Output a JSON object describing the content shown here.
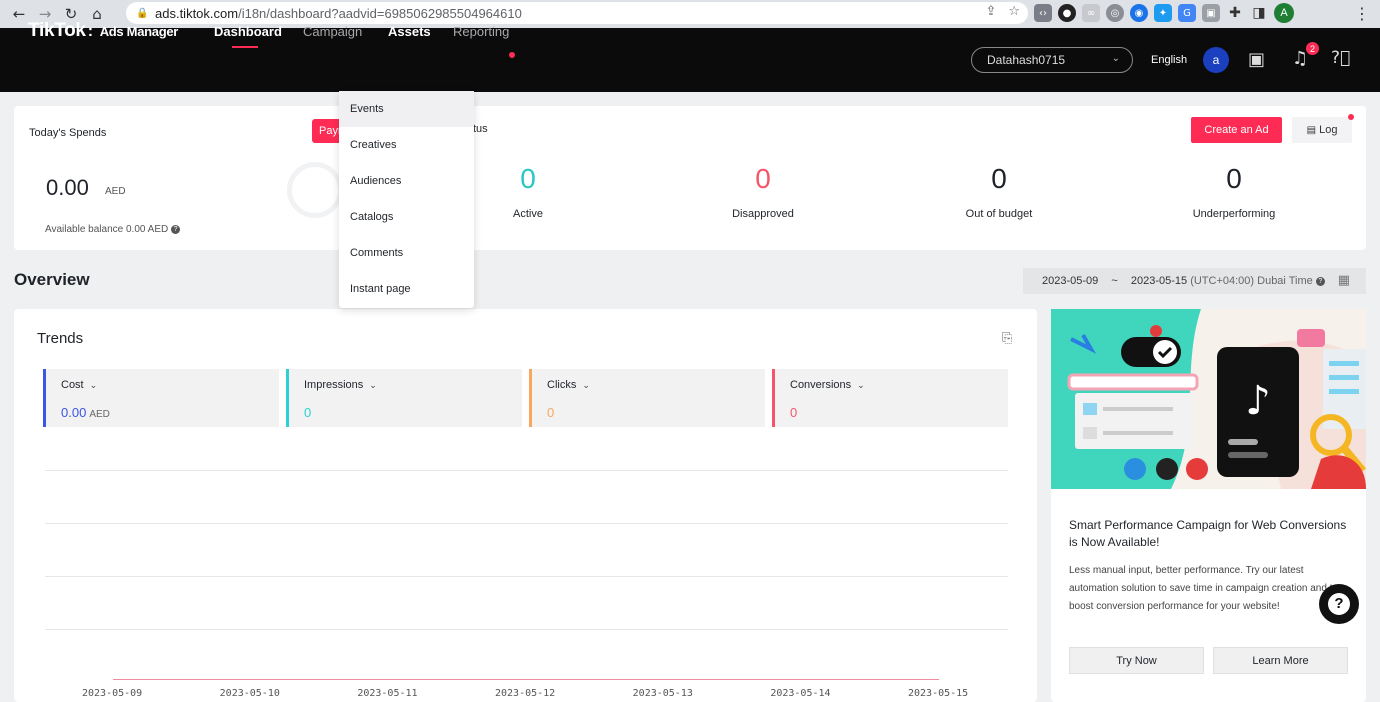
{
  "browser": {
    "url_host": "ads.tiktok.com",
    "url_path": "/i18n/dashboard?aadvid=6985062985504964610",
    "profile_initial": "A"
  },
  "nav": {
    "brand": "TikTok",
    "brand_sep": ":",
    "brand_sub": "Ads Manager",
    "items": [
      "Dashboard",
      "Campaign",
      "Assets",
      "Reporting"
    ],
    "account": "Datahash0715",
    "language": "English",
    "avatar_initial": "a",
    "notification_count": "2"
  },
  "assets_menu": {
    "items": [
      "Events",
      "Creatives",
      "Audiences",
      "Catalogs",
      "Comments",
      "Instant page"
    ]
  },
  "summary": {
    "today_title": "Today's Spends",
    "payment_label": "Paym",
    "spend_value": "0.00",
    "spend_currency": "AED",
    "balance": "Available balance 0.00 AED",
    "status_title": "tus",
    "stats": [
      {
        "value": "0",
        "label": "Active",
        "color": "#29c6c6"
      },
      {
        "value": "0",
        "label": "Disapproved",
        "color": "#f5556b"
      },
      {
        "value": "0",
        "label": "Out of budget",
        "color": "#1f2329"
      },
      {
        "value": "0",
        "label": "Underperforming",
        "color": "#1f2329"
      }
    ],
    "create_ad": "Create an Ad",
    "log": "Log"
  },
  "overview": {
    "title": "Overview",
    "date_start": "2023-05-09",
    "date_sep": "~",
    "date_end": "2023-05-15",
    "timezone": "(UTC+04:00) Dubai Time"
  },
  "trends": {
    "title": "Trends",
    "metrics": [
      {
        "label": "Cost",
        "value": "0.00",
        "unit": "AED",
        "color": "#3a55e8"
      },
      {
        "label": "Impressions",
        "value": "0",
        "unit": "",
        "color": "#2ed1cf"
      },
      {
        "label": "Clicks",
        "value": "0",
        "unit": "",
        "color": "#f7a75f"
      },
      {
        "label": "Conversions",
        "value": "0",
        "unit": "",
        "color": "#f5556b"
      }
    ]
  },
  "chart_data": {
    "type": "line",
    "x": [
      "2023-05-09",
      "2023-05-10",
      "2023-05-11",
      "2023-05-12",
      "2023-05-13",
      "2023-05-14",
      "2023-05-15"
    ],
    "series": [
      {
        "values": [
          0,
          0,
          0,
          0,
          0,
          0,
          0
        ]
      }
    ],
    "grid": true
  },
  "promo": {
    "title": "Smart Performance Campaign for Web Conversions is Now Available!",
    "description": "Less manual input, better performance. Try our latest automation solution to save time in campaign creation and to boost conversion performance for your website!",
    "try_now": "Try Now",
    "learn_more": "Learn More"
  }
}
